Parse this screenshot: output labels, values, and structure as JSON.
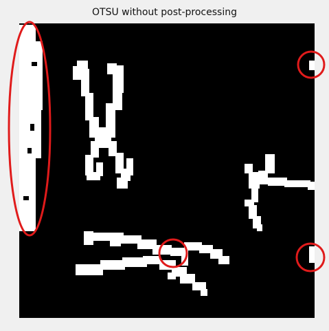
{
  "figure": {
    "title": "OTSU without post-processing"
  },
  "colors": {
    "background": "#f0f0f0",
    "axes_background": "#000000",
    "foreground_mask": "#ffffff",
    "annotation": "#e01b1b"
  },
  "content": {
    "image_type": "binary segmentation mask",
    "objects": [
      "scissors",
      "clamp",
      "forceps",
      "instrument"
    ],
    "annotations": [
      "ellipse",
      "circle",
      "circle",
      "circle",
      "circle"
    ]
  }
}
